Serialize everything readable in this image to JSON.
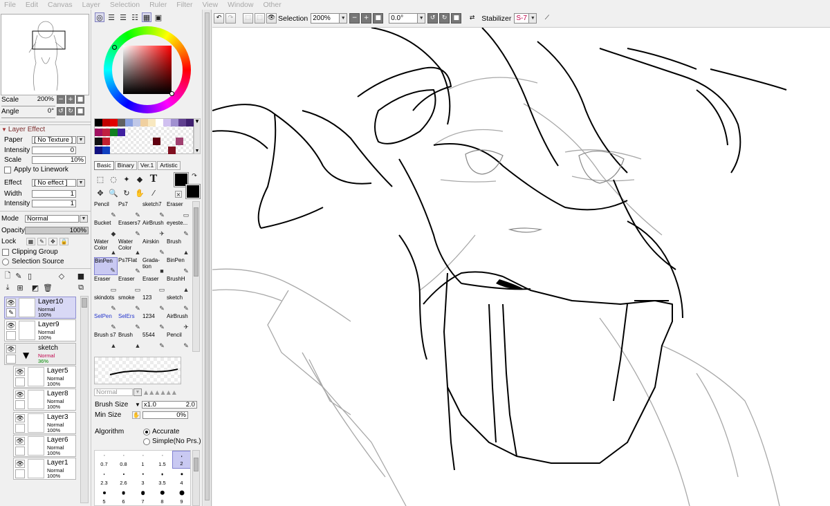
{
  "menu": [
    "File",
    "Edit",
    "Canvas",
    "Layer",
    "Selection",
    "Ruler",
    "Filter",
    "View",
    "Window",
    "Other"
  ],
  "navigator": {
    "scale_label": "Scale",
    "scale_value": "200%",
    "angle_label": "Angle",
    "angle_value": "0°"
  },
  "layer_effect": {
    "header": "Layer Effect",
    "paper_label": "Paper",
    "paper_value": "[ No Texture ]",
    "intensity_label": "Intensity",
    "intensity_value": "0",
    "scale_label": "Scale",
    "scale_value": "10%",
    "apply_linework": "Apply to Linework",
    "effect_label": "Effect",
    "effect_value": "[ No effect ]",
    "width_label": "Width",
    "width_value": "1",
    "intensity2_label": "Intensity",
    "intensity2_value": "1"
  },
  "layer_props": {
    "mode_label": "Mode",
    "mode_value": "Normal",
    "opacity_label": "Opacity",
    "opacity_value": "100%",
    "opacity_fraction": 1.0,
    "lock_label": "Lock",
    "clipping_group": "Clipping Group",
    "selection_source": "Selection Source"
  },
  "layers": [
    {
      "name": "Layer10",
      "mode": "Normal",
      "opacity": "100%"
    },
    {
      "name": "Layer9",
      "mode": "Normal",
      "opacity": "100%"
    },
    {
      "name": "sketch",
      "mode": "Normal",
      "opacity": "36%"
    },
    {
      "name": "Layer5",
      "mode": "Normal",
      "opacity": "100%"
    },
    {
      "name": "Layer8",
      "mode": "Normal",
      "opacity": "100%"
    },
    {
      "name": "Layer3",
      "mode": "Normal",
      "opacity": "100%"
    },
    {
      "name": "Layer6",
      "mode": "Normal",
      "opacity": "100%"
    },
    {
      "name": "Layer1",
      "mode": "Normal",
      "opacity": "100%"
    }
  ],
  "colors": {
    "primary": "#000000",
    "secondary": "#000000",
    "selected_layer_bg": "#d8d8f5",
    "sketch_mode_color": "#c0004a",
    "sketch_opacity_color": "#008a00",
    "stabilizer_color": "#c0004a",
    "blue_brush_color": "#2233cc"
  },
  "palette_row1": [
    "#000000",
    "#c00000",
    "#e00000",
    "#606060",
    "#8aa0e0",
    "#c0c8e8",
    "#f0d0a0",
    "#f8e8c0",
    "#ffffff",
    "#d0c0f0",
    "#a090d0",
    "#604090",
    "#402070"
  ],
  "palette_row2": [
    "#a01060",
    "#c02040",
    "#108020",
    "#4020a0"
  ],
  "palette_row3": [
    "#101010",
    "#c02030"
  ],
  "palette_row4": [
    "#101080",
    "#1040c0"
  ],
  "palette_extra": [
    "#600010",
    "#a04070",
    "#801020"
  ],
  "tool_tabs": [
    "Basic",
    "Binary",
    "Ver.1",
    "Artistic"
  ],
  "brushes": [
    {
      "label": "Pencil",
      "icon": "✎"
    },
    {
      "label": "Ps7",
      "icon": "✎"
    },
    {
      "label": "sketch7",
      "icon": "✎"
    },
    {
      "label": "Eraser",
      "icon": "▭"
    },
    {
      "label": "Bucket",
      "icon": "◆"
    },
    {
      "label": "Erasers7",
      "icon": "✎"
    },
    {
      "label": "AirBrush",
      "icon": "✈"
    },
    {
      "label": "eyeste...",
      "icon": "✎"
    },
    {
      "label": "Water Color",
      "icon": "▲"
    },
    {
      "label": "Water Color",
      "icon": "▲"
    },
    {
      "label": "Airskin",
      "icon": "✎"
    },
    {
      "label": "Brush",
      "icon": "▲"
    },
    {
      "label": "BinPen",
      "icon": "✎"
    },
    {
      "label": "Ps7Flat",
      "icon": "✎"
    },
    {
      "label": "Grada- tion",
      "icon": "■"
    },
    {
      "label": "BinPen",
      "icon": "✎"
    },
    {
      "label": "Eraser",
      "icon": "▭"
    },
    {
      "label": "Eraser",
      "icon": "▭"
    },
    {
      "label": "Eraser",
      "icon": "▭"
    },
    {
      "label": "BrushH",
      "icon": "▲"
    },
    {
      "label": "skindots",
      "icon": "✎"
    },
    {
      "label": "smoke",
      "icon": "✎"
    },
    {
      "label": "123",
      "icon": "✎"
    },
    {
      "label": "sketch",
      "icon": "✎"
    },
    {
      "label": "SelPen",
      "icon": "✎"
    },
    {
      "label": "SelErs",
      "icon": "✎"
    },
    {
      "label": "1234",
      "icon": "✎"
    },
    {
      "label": "AirBrush",
      "icon": "✈"
    },
    {
      "label": "Brush s7",
      "icon": "▲"
    },
    {
      "label": "Brush",
      "icon": "▲"
    },
    {
      "label": "5544",
      "icon": "✎"
    },
    {
      "label": "Pencil",
      "icon": "✎"
    }
  ],
  "brush_options": {
    "blend_value": "Normal",
    "brush_size_label": "Brush Size",
    "brush_size_mult": "x1.0",
    "brush_size_value": "2.0",
    "min_size_label": "Min Size",
    "min_size_value": "0%",
    "algorithm_label": "Algorithm",
    "accurate": "Accurate",
    "simple": "Simple(No Prs.)"
  },
  "size_presets": [
    "0.7",
    "0.8",
    "1",
    "1.5",
    "2",
    "2.3",
    "2.6",
    "3",
    "3.5",
    "4",
    "5",
    "6",
    "7",
    "8",
    "9"
  ],
  "toolbar": {
    "selection_label": "Selection",
    "zoom_value": "200%",
    "rotation_value": "0.0°",
    "stabilizer_label": "Stabilizer",
    "stabilizer_value": "S-7"
  }
}
